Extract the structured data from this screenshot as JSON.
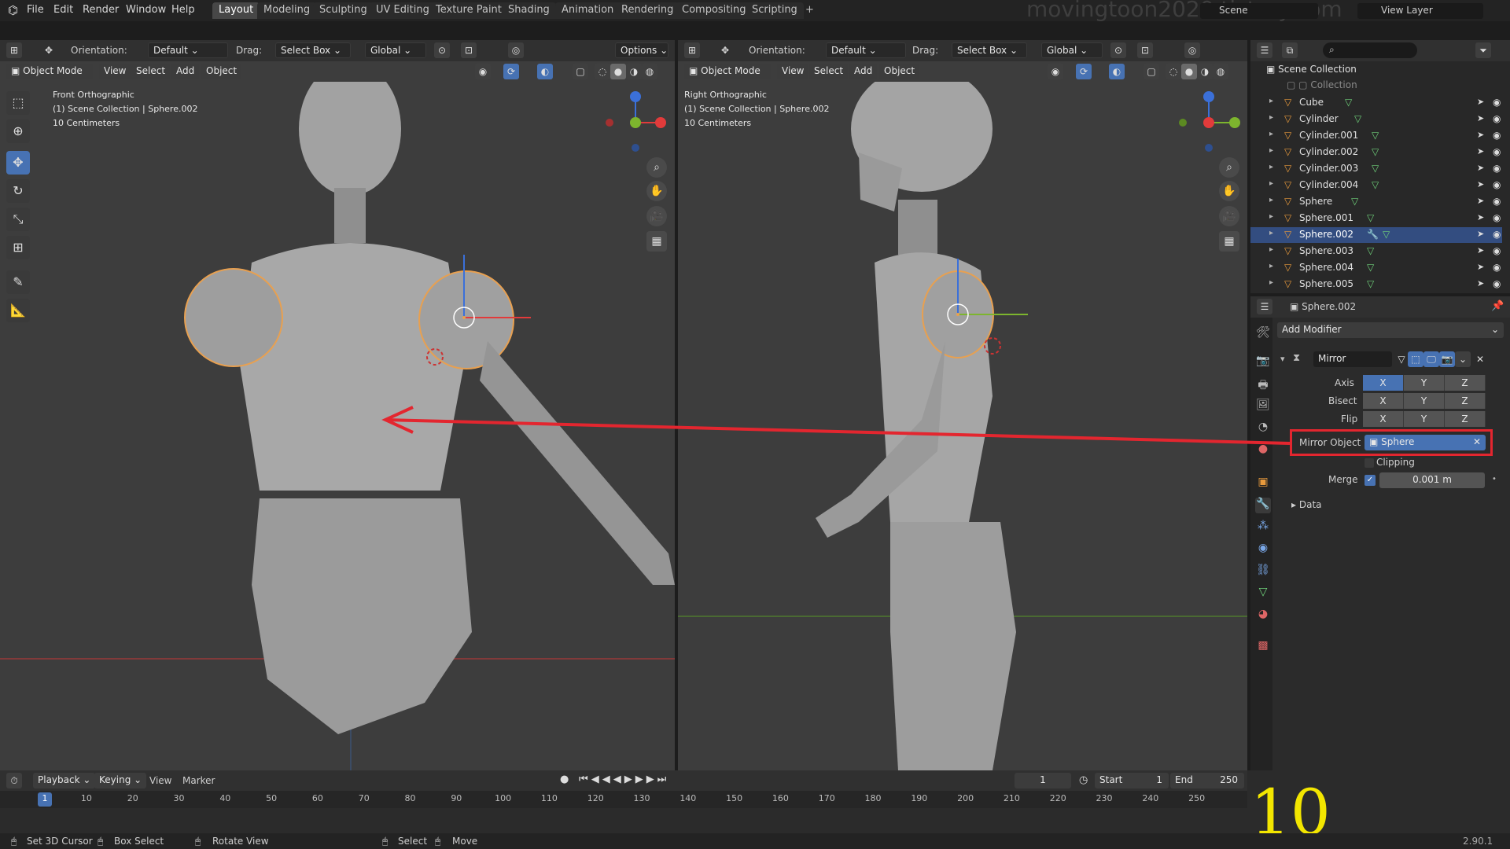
{
  "menu": [
    "File",
    "Edit",
    "Render",
    "Window",
    "Help"
  ],
  "workspaces": [
    "Layout",
    "Modeling",
    "Sculpting",
    "UV Editing",
    "Texture Paint",
    "Shading",
    "Animation",
    "Rendering",
    "Compositing",
    "Scripting",
    "+"
  ],
  "scene": "Scene",
  "view_layer": "View Layer",
  "watermark": "movingtoon2020.tistory.com",
  "left_header": {
    "orientation_label": "Orientation:",
    "orientation": "Default",
    "drag_label": "Drag:",
    "drag": "Select Box",
    "transform": "Global",
    "options": "Options"
  },
  "left_sub": {
    "mode": "Object Mode",
    "view": "View",
    "select": "Select",
    "add": "Add",
    "object": "Object"
  },
  "left_overlay": {
    "title": "Front Orthographic",
    "collection": "(1) Scene Collection | Sphere.002",
    "scale": "10 Centimeters"
  },
  "right_header": {
    "orientation_label": "Orientation:",
    "orientation": "Default",
    "drag_label": "Drag:",
    "drag": "Select Box",
    "transform": "Global"
  },
  "right_sub": {
    "mode": "Object Mode",
    "view": "View",
    "select": "Select",
    "add": "Add",
    "object": "Object"
  },
  "right_overlay": {
    "title": "Right Orthographic",
    "collection": "(1) Scene Collection | Sphere.002",
    "scale": "10 Centimeters"
  },
  "outliner": {
    "root": "Scene Collection",
    "collection": "Collection",
    "items": [
      "Cube",
      "Cylinder",
      "Cylinder.001",
      "Cylinder.002",
      "Cylinder.003",
      "Cylinder.004",
      "Sphere",
      "Sphere.001",
      "Sphere.002",
      "Sphere.003",
      "Sphere.004",
      "Sphere.005"
    ]
  },
  "properties": {
    "object": "Sphere.002",
    "add_modifier": "Add Modifier",
    "modifier_name": "Mirror",
    "axis_label": "Axis",
    "bisect_label": "Bisect",
    "flip_label": "Flip",
    "axes": [
      "X",
      "Y",
      "Z"
    ],
    "mirror_object_label": "Mirror Object",
    "mirror_object": "Sphere",
    "clipping": "Clipping",
    "merge_label": "Merge",
    "merge_value": "0.001 m",
    "data": "Data"
  },
  "timeline": {
    "playback": "Playback",
    "keying": "Keying",
    "view": "View",
    "marker": "Marker",
    "frame": "1",
    "start_label": "Start",
    "start": "1",
    "end_label": "End",
    "end": "250",
    "ticks": [
      "1",
      "10",
      "20",
      "30",
      "40",
      "50",
      "60",
      "70",
      "80",
      "90",
      "100",
      "110",
      "120",
      "130",
      "140",
      "150",
      "160",
      "170",
      "180",
      "190",
      "200",
      "210",
      "220",
      "230",
      "240",
      "250"
    ]
  },
  "status": {
    "cursor": "Set 3D Cursor",
    "box": "Box Select",
    "rotate": "Rotate View",
    "select": "Select",
    "move": "Move",
    "version": "2.90.1"
  },
  "step_number": "10"
}
